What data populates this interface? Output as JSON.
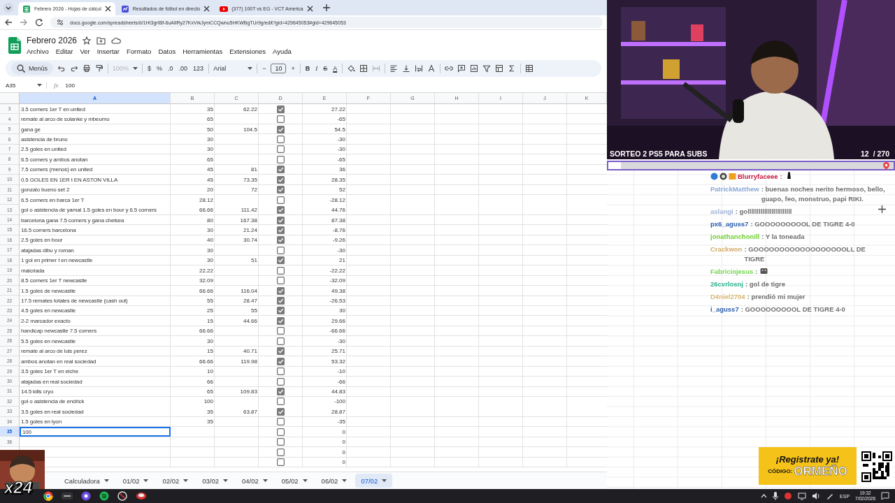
{
  "browser": {
    "tabs": [
      {
        "title": "Febrero 2026 - Hojas de cálcul",
        "selected": true
      },
      {
        "title": "Resultados de fútbol en directo",
        "selected": false
      },
      {
        "title": "(377) 100T vs EG - VCT America",
        "selected": false
      }
    ],
    "url": "docs.google.com/spreadsheets/d/1HI3grIBf-6uAIlRy27KxVrkJymCCQwnu5HKWBgTUr9g/edit?gid=429645053#gid=429645053"
  },
  "document": {
    "title": "Febrero 2026",
    "menu": [
      "Archivo",
      "Editar",
      "Ver",
      "Insertar",
      "Formato",
      "Datos",
      "Herramientas",
      "Extensiones",
      "Ayuda"
    ]
  },
  "toolbar": {
    "search": "Menús",
    "zoom": {
      "value": "100%",
      "disabled": true
    },
    "number_formats": [
      "$",
      "%",
      ".0",
      ".00",
      "123"
    ],
    "font": "Arial",
    "size_minus": "−",
    "font_size": "10",
    "size_plus": "+",
    "styles": [
      "B",
      "I",
      "S",
      "A"
    ]
  },
  "formula_bar": {
    "cell": "A35",
    "fx": "fx",
    "value": "100"
  },
  "columns": [
    {
      "label": "A",
      "selected": true
    },
    {
      "label": "B",
      "selected": false
    },
    {
      "label": "C",
      "selected": false
    },
    {
      "label": "D",
      "selected": false
    },
    {
      "label": "E",
      "selected": false
    },
    {
      "label": "F",
      "selected": false
    },
    {
      "label": "G",
      "selected": false
    },
    {
      "label": "H",
      "selected": false
    },
    {
      "label": "I",
      "selected": false
    },
    {
      "label": "J",
      "selected": false
    },
    {
      "label": "K",
      "selected": false
    }
  ],
  "rows": [
    {
      "number": "3",
      "a": "3.5 corners 1er T en united",
      "b": "35",
      "c": "62.22",
      "checked": true,
      "e": "27.22",
      "selected": false
    },
    {
      "number": "4",
      "a": "remate al arco de solanke y mbeumo",
      "b": "65",
      "checked": false,
      "e": "-65",
      "selected": false
    },
    {
      "number": "5",
      "a": "gana ge",
      "b": "50",
      "c": "104.5",
      "checked": true,
      "e": "54.5",
      "selected": false
    },
    {
      "number": "6",
      "a": "asistencia de bruno",
      "b": "30",
      "checked": false,
      "e": "-30",
      "selected": false
    },
    {
      "number": "7",
      "a": "2.5 goles en united",
      "b": "30",
      "checked": false,
      "e": "-30",
      "selected": false
    },
    {
      "number": "8",
      "a": "6.5 corners y ambos anotan",
      "b": "65",
      "checked": false,
      "e": "-65",
      "selected": false
    },
    {
      "number": "9",
      "a": "7.5 corners (menos) en united",
      "b": "45",
      "c": "81",
      "checked": true,
      "e": "36",
      "selected": false
    },
    {
      "number": "10",
      "a": "0.5 GOLES EN 1ER t EN ASTON VILLA",
      "b": "45",
      "c": "73.35",
      "checked": true,
      "e": "28.35",
      "selected": false
    },
    {
      "number": "11",
      "a": "gonzalo bueno set 2",
      "b": "20",
      "c": "72",
      "checked": true,
      "e": "52",
      "selected": false
    },
    {
      "number": "12",
      "a": "6.5 corners en barca 1er T",
      "b": "28.12",
      "checked": false,
      "e": "-28.12",
      "selected": false
    },
    {
      "number": "13",
      "a": "gol o asistencia de yamal 1.5 goles en bour y 6.5 corners",
      "b": "66.66",
      "c": "111.42",
      "checked": true,
      "e": "44.76",
      "selected": false
    },
    {
      "number": "14",
      "a": "barcelona gana 7.5 corners y gana chelsea",
      "b": "80",
      "c": "167.38",
      "checked": true,
      "e": "87.38",
      "selected": false
    },
    {
      "number": "15",
      "a": "16.5 corners barcelona",
      "b": "30",
      "c": "21.24",
      "checked": true,
      "e": "-8.76",
      "selected": false
    },
    {
      "number": "16",
      "a": "2.5 goles en bour",
      "b": "40",
      "c": "30.74",
      "checked": true,
      "e": "-9.26",
      "selected": false
    },
    {
      "number": "17",
      "a": "atajadas dibu y roman",
      "b": "30",
      "checked": false,
      "e": "-30",
      "selected": false
    },
    {
      "number": "18",
      "a": "1 gol en primer t en newcastle",
      "b": "30",
      "c": "51",
      "checked": true,
      "e": "21",
      "selected": false
    },
    {
      "number": "19",
      "a": "malcriada",
      "b": "22.22",
      "checked": false,
      "e": "-22.22",
      "selected": false
    },
    {
      "number": "20",
      "a": "8.5 corners 1er T newcastle",
      "b": "32.09",
      "checked": false,
      "e": "-32.09",
      "selected": false
    },
    {
      "number": "21",
      "a": "1.5 goles de newcastle",
      "b": "66.66",
      "c": "116.04",
      "checked": true,
      "e": "49.38",
      "selected": false
    },
    {
      "number": "22",
      "a": "17.5 remates totales de newcastle (cash out)",
      "b": "55",
      "c": "28.47",
      "checked": true,
      "e": "-26.53",
      "selected": false
    },
    {
      "number": "23",
      "a": "4.5 goles en newcastle",
      "b": "25",
      "c": "55",
      "checked": true,
      "e": "30",
      "selected": false
    },
    {
      "number": "24",
      "a": "2-2 marcador exacto",
      "b": "15",
      "c": "44.66",
      "checked": true,
      "e": "29.66",
      "selected": false
    },
    {
      "number": "25",
      "a": "handicap newcastle 7.5 corners",
      "b": "66.66",
      "checked": false,
      "e": "-66.66",
      "selected": false
    },
    {
      "number": "26",
      "a": "5.5 goles en newcastle",
      "b": "30",
      "checked": false,
      "e": "-30",
      "selected": false
    },
    {
      "number": "27",
      "a": "remate al arco de luis perez",
      "b": "15",
      "c": "40.71",
      "checked": true,
      "e": "25.71",
      "selected": false
    },
    {
      "number": "28",
      "a": "ambos anotan en real sociedad",
      "b": "66.66",
      "c": "119.98",
      "checked": true,
      "e": "53.32",
      "selected": false
    },
    {
      "number": "29",
      "a": "3.5 goles 1er T en elche",
      "b": "10",
      "checked": false,
      "e": "-10",
      "selected": false
    },
    {
      "number": "30",
      "a": "atajadas en real sociedad",
      "b": "66",
      "checked": false,
      "e": "-66",
      "selected": false
    },
    {
      "number": "31",
      "a": "14.5 kills cryo",
      "b": "65",
      "c": "109.83",
      "checked": true,
      "e": "44.83",
      "selected": false
    },
    {
      "number": "32",
      "a": "gol o asistencia de endrick",
      "b": "100",
      "checked": false,
      "e": "-100",
      "selected": false
    },
    {
      "number": "33",
      "a": "3.5 goles en real sociedad",
      "b": "35",
      "c": "63.87",
      "checked": true,
      "e": "28.87",
      "selected": false
    },
    {
      "number": "34",
      "a": "1.5 goles en lyon",
      "b": "35",
      "checked": false,
      "e": "-35",
      "selected": false
    },
    {
      "number": "35",
      "a": "100",
      "checked": false,
      "e": "0",
      "selected": true
    },
    {
      "number": "36",
      "checked": false,
      "e": "0",
      "selected": false
    },
    {
      "checked": false,
      "e": "0"
    },
    {
      "checked": false,
      "e": "0"
    }
  ],
  "sheet_tabs": [
    {
      "label": "Calculadora",
      "selected": false
    },
    {
      "label": "01/02",
      "selected": false
    },
    {
      "label": "02/02",
      "selected": false
    },
    {
      "label": "03/02",
      "selected": false
    },
    {
      "label": "04/02",
      "selected": false
    },
    {
      "label": "05/02",
      "selected": false
    },
    {
      "label": "06/02",
      "selected": false
    },
    {
      "label": "07/02",
      "selected": true
    }
  ],
  "stream": {
    "goal_title": "SORTEO 2 PS5 PARA SUBS",
    "goal_current": "12",
    "goal_total": "/ 270",
    "goal": {
      "level": 0.044
    },
    "chat": [
      {
        "user": "Blurryfaceee",
        "color": "#c8123c",
        "text": ":",
        "kind": "emote",
        "badges": true
      },
      {
        "user": "PatrickMatthew",
        "color": "#8aa6d6",
        "text": ": buenas noches nerito hermoso, bello, guapo, feo, monstruo, papi RIKI.",
        "kind": "text"
      },
      {
        "user": "aslangi",
        "color": "#9fb2d4",
        "text": ": gollllllllllllllllllllllll",
        "kind": "text"
      },
      {
        "user": "px6_aguss7",
        "color": "#2f5fae",
        "text": ": GOOOOOOOOOL DE TIGRE 4-0",
        "kind": "text"
      },
      {
        "user": "jonathanchonill",
        "color": "#6fd12f",
        "text": ": Y la toneada",
        "kind": "text"
      },
      {
        "user": "Crackwon",
        "color": "#d2a962",
        "text": ": GOOOOOOOOOOOOOOOOOOLL DE TIGRE",
        "kind": "text"
      },
      {
        "user": "Fabriciojesus",
        "color": "#74d650",
        "text": ":",
        "kind": "emote"
      },
      {
        "user": "26cvrlosnj",
        "color": "#2fb38f",
        "text": ": gol de tigre",
        "kind": "text"
      },
      {
        "user": "D4niel2704",
        "color": "#d9b872",
        "text": ": prendió mi mujer",
        "kind": "text"
      },
      {
        "user": "i_aguss7",
        "color": "#2f5fae",
        "text": ": GOOOOOOOOOL DE TIGRE 4-0",
        "kind": "text"
      }
    ],
    "multiplier": "x24",
    "promo": {
      "headline": "¡Registrate ya!",
      "code_label": "CÓDIGO:",
      "code": "ORMEÑO"
    }
  },
  "taskbar": {
    "language": "ESP",
    "time": "19:32",
    "date": "7/02/2026"
  }
}
